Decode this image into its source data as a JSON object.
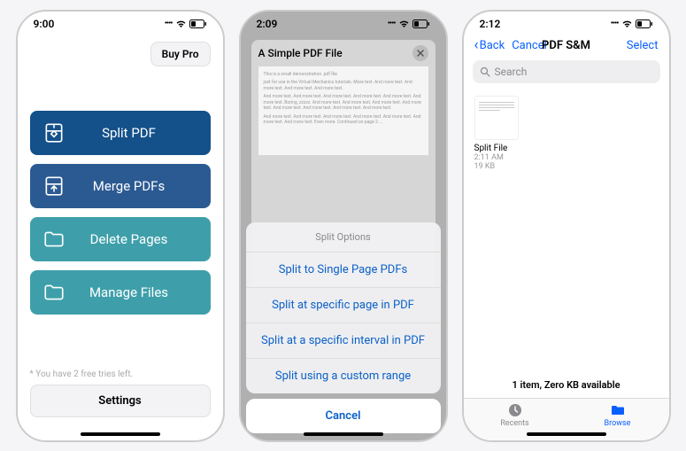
{
  "screen1": {
    "time": "9:00",
    "buy_pro": "Buy Pro",
    "actions": {
      "split": "Split PDF",
      "merge": "Merge PDFs",
      "delete": "Delete Pages",
      "manage": "Manage Files"
    },
    "footer_note": "* You have 2 free tries left.",
    "settings": "Settings"
  },
  "screen2": {
    "time": "2:09",
    "pdf_title": "A Simple PDF File",
    "pdf_subtitle": "This is a small demonstration .pdf file",
    "pdf_body1": "just for use in the Virtual Mechanics tutorials. More text. And more text. And more text. And more text. And more text.",
    "pdf_body2": "And more text. And more text. And more text. And more text. And more text. And more text. Boring, zzzzz. And more text. And more text. And more text. And more text. And more text. And more text. And more text. And more text.",
    "pdf_body3": "And more text. And more text. And more text. And more text. And more text. And more text. And more text. Even more. Continued on page 2 ...",
    "sheet_title": "Split Options",
    "opt1": "Split to Single Page PDFs",
    "opt2": "Split at specific page in PDF",
    "opt3": "Split at a specific interval in PDF",
    "opt4": "Split using a custom range",
    "cancel": "Cancel"
  },
  "screen3": {
    "time": "2:12",
    "back": "Back",
    "cancel": "Cancel",
    "title": "PDF S&M",
    "select": "Select",
    "search_placeholder": "Search",
    "file": {
      "name": "Split File",
      "time": "2:11 AM",
      "size": "19 KB"
    },
    "status": "1 item, Zero KB available",
    "tab_recents": "Recents",
    "tab_browse": "Browse"
  }
}
